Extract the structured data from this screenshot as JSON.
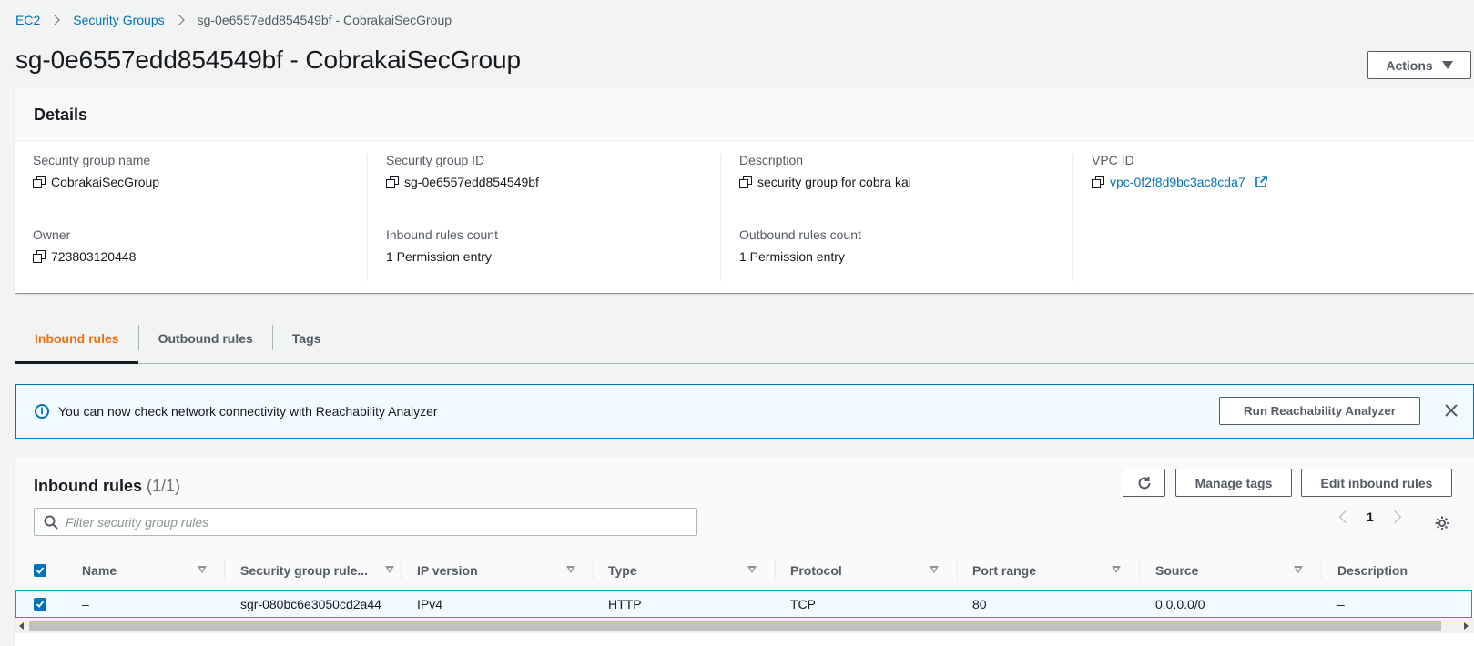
{
  "breadcrumb": {
    "items": [
      "EC2",
      "Security Groups"
    ],
    "current": "sg-0e6557edd854549bf - CobrakaiSecGroup"
  },
  "page": {
    "title": "sg-0e6557edd854549bf - CobrakaiSecGroup",
    "actions_label": "Actions"
  },
  "details": {
    "heading": "Details",
    "fields": [
      {
        "key": "Security group name",
        "value": "CobrakaiSecGroup"
      },
      {
        "key": "Security group ID",
        "value": "sg-0e6557edd854549bf"
      },
      {
        "key": "Description",
        "value": "security group for cobra kai"
      },
      {
        "key": "VPC ID",
        "value": "vpc-0f2f8d9bc3ac8cda7"
      },
      {
        "key": "Owner",
        "value": "723803120448"
      },
      {
        "key": "Inbound rules count",
        "value": "1 Permission entry"
      },
      {
        "key": "Outbound rules count",
        "value": "1 Permission entry"
      }
    ]
  },
  "tabs": [
    {
      "label": "Inbound rules",
      "active": true
    },
    {
      "label": "Outbound rules",
      "active": false
    },
    {
      "label": "Tags",
      "active": false
    }
  ],
  "flash": {
    "message": "You can now check network connectivity with Reachability Analyzer",
    "button_label": "Run Reachability Analyzer"
  },
  "rules": {
    "title": "Inbound rules",
    "count": "(1/1)",
    "manage_tags_label": "Manage tags",
    "edit_label": "Edit inbound rules",
    "search_placeholder": "Filter security group rules",
    "page_number": "1",
    "columns": [
      "Name",
      "Security group rule...",
      "IP version",
      "Type",
      "Protocol",
      "Port range",
      "Source",
      "Description"
    ],
    "rows": [
      {
        "name": "–",
        "rule_id": "sgr-080bc6e3050cd2a44",
        "ip_version": "IPv4",
        "type": "HTTP",
        "protocol": "TCP",
        "port_range": "80",
        "source": "0.0.0.0/0",
        "description": "–"
      }
    ]
  },
  "colors": {
    "link": "#0073bb",
    "active_tab": "#ec7211",
    "flash_bg": "#f1faff",
    "flash_border": "#0073bb"
  }
}
